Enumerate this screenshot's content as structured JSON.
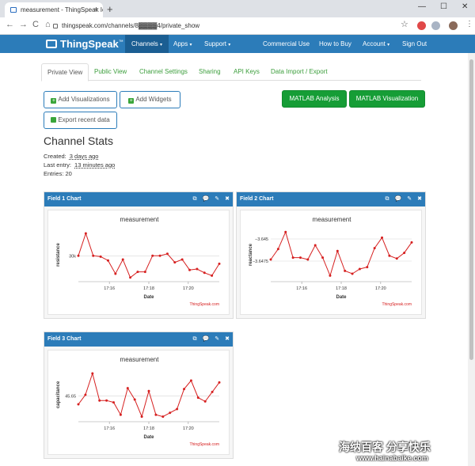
{
  "browser": {
    "tab_title": "measurement - ThingSpeak IoT",
    "tab_close": "×",
    "new_tab": "+",
    "window_controls": {
      "minimize": "—",
      "maximize": "☐",
      "close": "✕"
    },
    "back": "←",
    "forward": "→",
    "reload": "C",
    "home": "⌂",
    "url": "thingspeak.com/channels/8▓▓▓▓4/private_show",
    "star": "☆",
    "menu": "⋮"
  },
  "nav": {
    "logo": "ThingSpeak",
    "logo_tm": "™",
    "items": [
      {
        "label": "Channels",
        "caret": "▾",
        "active": true
      },
      {
        "label": "Apps",
        "caret": "▾"
      },
      {
        "label": "Support",
        "caret": "▾"
      },
      {
        "label": "Commercial Use"
      },
      {
        "label": "How to Buy"
      },
      {
        "label": "Account",
        "caret": "▾"
      },
      {
        "label": "Sign Out"
      }
    ]
  },
  "tabs": [
    "Private View",
    "Public View",
    "Channel Settings",
    "Sharing",
    "API Keys",
    "Data Import / Export"
  ],
  "buttons": {
    "add_visualizations": "Add Visualizations",
    "add_widgets": "Add Widgets",
    "export": "Export recent data",
    "matlab_analysis": "MATLAB Analysis",
    "matlab_visualization": "MATLAB Visualization",
    "plus": "+"
  },
  "stats": {
    "title": "Channel Stats",
    "created_label": "Created:",
    "created_value": "3 days ago",
    "last_label": "Last entry:",
    "last_value": "13 minutes ago",
    "entries": "Entries: 20"
  },
  "panel_icons": {
    "popout": "⧉",
    "comment": "💬",
    "edit": "✎",
    "close": "✖"
  },
  "watermark": {
    "text": "海纳百客 分享快乐",
    "url": "www.hainabaike.com"
  },
  "chart_data": [
    {
      "type": "line",
      "title": "Field 1 Chart",
      "chart_title": "measurement",
      "xlabel": "Date",
      "ylabel": "resistance",
      "ytick": "30k",
      "xticks": [
        "17:16",
        "17:18",
        "17:20"
      ],
      "credit": "ThingSpeak.com",
      "color": "#d62020",
      "values": [
        0.48,
        0.95,
        0.48,
        0.46,
        0.38,
        0.1,
        0.4,
        0.02,
        0.14,
        0.14,
        0.48,
        0.48,
        0.52,
        0.34,
        0.4,
        0.18,
        0.2,
        0.12,
        0.06,
        0.31
      ]
    },
    {
      "type": "line",
      "title": "Field 2 Chart",
      "chart_title": "measurement",
      "xlabel": "Date",
      "ylabel": "reactance",
      "yticks": [
        "−3.645",
        "−3.6475"
      ],
      "xticks": [
        "17:16",
        "17:18",
        "17:20"
      ],
      "credit": "ThingSpeak.com",
      "color": "#d62020",
      "values": [
        0.4,
        0.62,
        0.98,
        0.44,
        0.44,
        0.4,
        0.7,
        0.44,
        0.06,
        0.58,
        0.16,
        0.1,
        0.2,
        0.24,
        0.64,
        0.86,
        0.48,
        0.42,
        0.54,
        0.76
      ]
    },
    {
      "type": "line",
      "title": "Field 3 Chart",
      "chart_title": "measurement",
      "xlabel": "Date",
      "ylabel": "capacitance",
      "ytick": "45.65",
      "xticks": [
        "17:16",
        "17:18",
        "17:20"
      ],
      "credit": "ThingSpeak.com",
      "color": "#d62020",
      "values": [
        0.3,
        0.5,
        0.95,
        0.38,
        0.38,
        0.34,
        0.08,
        0.64,
        0.4,
        0.04,
        0.58,
        0.08,
        0.04,
        0.12,
        0.2,
        0.62,
        0.8,
        0.44,
        0.36,
        0.56,
        0.76
      ]
    }
  ]
}
